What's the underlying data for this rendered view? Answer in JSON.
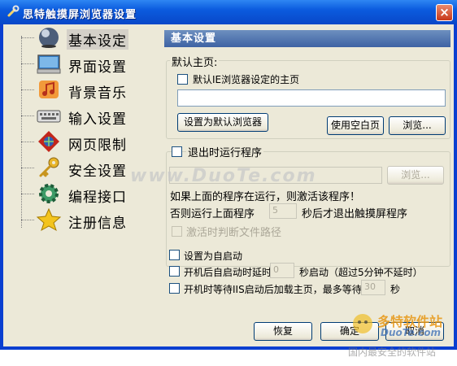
{
  "window": {
    "title": "思特触摸屏浏览器设置",
    "close_label": "×"
  },
  "sidebar": {
    "items": [
      {
        "label": "基本设定",
        "icon": "globe-icon"
      },
      {
        "label": "界面设置",
        "icon": "monitor-icon"
      },
      {
        "label": "背景音乐",
        "icon": "music-icon"
      },
      {
        "label": "输入设置",
        "icon": "keyboard-icon"
      },
      {
        "label": "网页限制",
        "icon": "web-restrict-icon"
      },
      {
        "label": "安全设置",
        "icon": "key-icon"
      },
      {
        "label": "编程接口",
        "icon": "gear-icon"
      },
      {
        "label": "注册信息",
        "icon": "star-icon"
      }
    ],
    "selected_index": 0
  },
  "panel": {
    "header": "基本设置",
    "homepage": {
      "legend": "默认主页:",
      "use_ie_label": "默认IE浏览器设定的主页",
      "url_value": "",
      "set_default_button": "设置为默认浏览器",
      "blank_button": "使用空白页",
      "browse_button": "浏览..."
    },
    "exit_program": {
      "legend": "退出时运行程序",
      "path_value": "",
      "browse_button": "浏览...",
      "line1": "如果上面的程序在运行，则激活该程序！",
      "line2_prefix": "否则运行上面程序",
      "seconds_value": "5",
      "line2_suffix": "秒后才退出触摸屏程序",
      "check_path_label": "激活时判断文件路径"
    },
    "autostart_label": "设置为自启动",
    "delay_prefix": "开机后自启动时延时",
    "delay_value": "0",
    "delay_suffix": "秒启动（超过5分钟不延时）",
    "iis_prefix": "开机时等待IIS启动后加载主页，最多等待",
    "iis_value": "30",
    "iis_suffix": "秒",
    "restore_button": "恢复",
    "ok_button": "确定",
    "cancel_button": "取消"
  },
  "watermark": {
    "text": "www.DuoTe.com",
    "logo_line1": "多特软件站",
    "logo_line2": "DuoTe.com",
    "logo_line3": "国内最安全的软件站"
  },
  "colors": {
    "titlebar": "#0b5bde",
    "client": "#ece9d8",
    "header": "#4a6fae"
  }
}
